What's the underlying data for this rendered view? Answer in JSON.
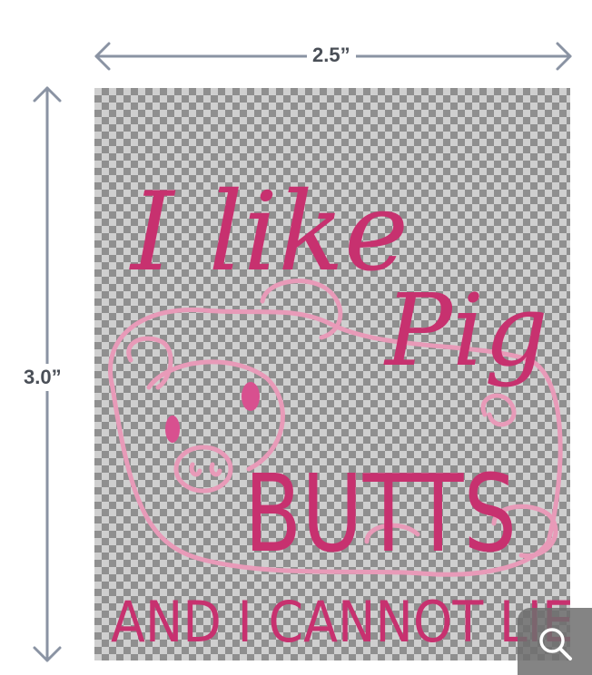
{
  "dimensions": {
    "width_label": "2.5”",
    "height_label": "3.0”"
  },
  "design": {
    "line1": "I like",
    "line2": "Pig",
    "line3": "BUTTS",
    "line4": "AND I CANNOT LIE",
    "text_color": "#c7316f",
    "pig_outline_color": "#e89ab8",
    "checker_dark": "#8f8f8f",
    "checker_light": "#cfcfcf"
  },
  "controls": {
    "zoom_icon": "magnifier-icon"
  },
  "colors": {
    "arrow": "#8a93a3",
    "label": "#4a4f57"
  }
}
